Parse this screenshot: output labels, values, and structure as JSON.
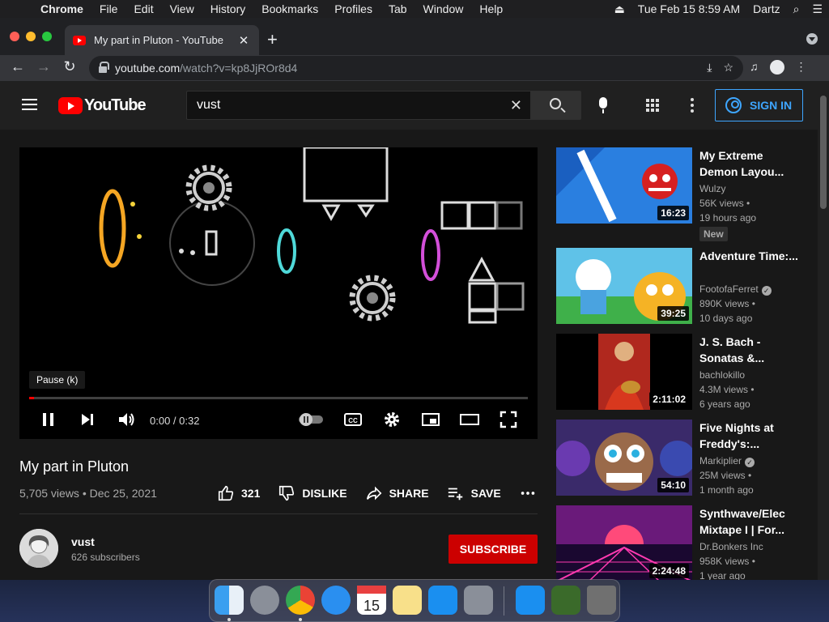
{
  "menubar": {
    "app": "Chrome",
    "items": [
      "File",
      "Edit",
      "View",
      "History",
      "Bookmarks",
      "Profiles",
      "Tab",
      "Window",
      "Help"
    ],
    "clock": "Tue Feb 15  8:59 AM",
    "user": "Dartz"
  },
  "browser": {
    "tab_title": "My part in Pluton - YouTube",
    "url_host": "youtube.com",
    "url_path": "/watch?v=kp8JjROr8d4"
  },
  "youtube": {
    "logo_text": "YouTube",
    "search_value": "vust",
    "sign_in": "SIGN IN"
  },
  "player": {
    "tooltip": "Pause (k)",
    "time": "0:00 / 0:32",
    "progress_fraction": 0.01
  },
  "video": {
    "title": "My part in Pluton",
    "meta": "5,705 views • Dec 25, 2021",
    "likes": "321",
    "dislike": "DISLIKE",
    "share": "SHARE",
    "save": "SAVE",
    "channel_name": "vust",
    "subscribers": "626 subscribers",
    "subscribe": "SUBSCRIBE"
  },
  "recommendations": [
    {
      "title": "My Extreme Demon Layou...",
      "channel": "Wulzy",
      "views": "56K views •",
      "age": "19 hours ago",
      "duration": "16:23",
      "badge": "New",
      "verified": false,
      "thumb_color": "#2a7fe0"
    },
    {
      "title": "Adventure Time:...",
      "channel": "FootofaFerret",
      "views": "890K views •",
      "age": "10 days ago",
      "duration": "39:25",
      "verified": true,
      "thumb_color": "#5fc2e8"
    },
    {
      "title": "J. S. Bach - Sonatas &...",
      "channel": "bachlokillo",
      "views": "4.3M views •",
      "age": "6 years ago",
      "duration": "2:11:02",
      "verified": false,
      "thumb_color": "#b0281e"
    },
    {
      "title": "Five Nights at Freddy's:...",
      "channel": "Markiplier",
      "views": "25M views •",
      "age": "1 month ago",
      "duration": "54:10",
      "verified": true,
      "thumb_color": "#3a2a6a"
    },
    {
      "title": "Synthwave/Elec Mixtape I | For...",
      "channel": "Dr.Bonkers Inc",
      "views": "958K views •",
      "age": "1 year ago",
      "duration": "2:24:48",
      "verified": false,
      "thumb_color": "#6a1a7a"
    }
  ],
  "colors": {
    "accent_red": "#ff0000",
    "subscribe_red": "#cc0000",
    "link_blue": "#3ea6ff",
    "page_bg": "#181818"
  }
}
